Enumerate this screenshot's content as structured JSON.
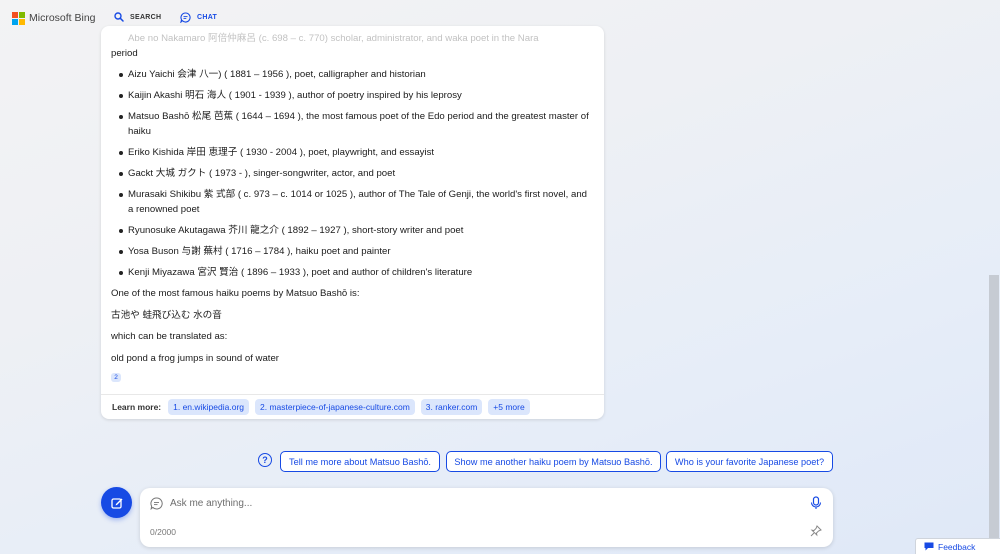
{
  "header": {
    "brand": "Microsoft Bing",
    "tabs": [
      {
        "label": "SEARCH",
        "icon": "search-icon"
      },
      {
        "label": "CHAT",
        "icon": "chat-bubble-icon",
        "active": true
      }
    ]
  },
  "answer": {
    "faded_line": "Abe no Nakamaro 阿倍仲麻呂 (c. 698 – c. 770) scholar, administrator, and waka poet in the Nara",
    "faded_continuation": "period",
    "poets": [
      "Aizu Yaichi 会津 八一) ( 1881 – 1956 ), poet, calligrapher and historian",
      "Kaijin Akashi 明石 海人 ( 1901 - 1939 ), author of poetry inspired by his leprosy",
      "Matsuo Bashō 松尾 芭蕉 ( 1644 – 1694 ), the most famous poet of the Edo period and the greatest master of haiku",
      "Eriko Kishida 岸田 恵理子 ( 1930 - 2004 ), poet, playwright, and essayist",
      "Gackt 大城 ガクト ( 1973 - ), singer-songwriter, actor, and poet",
      "Murasaki Shikibu 紫 式部 ( c. 973 – c. 1014 or 1025 ), author of The Tale of Genji, the world's first novel, and a renowned poet",
      "Ryunosuke Akutagawa 芥川 龍之介 ( 1892 – 1927 ), short-story writer and poet",
      "Yosa Buson 与謝 蕪村 ( 1716 – 1784 ), haiku poet and painter",
      "Kenji Miyazawa 宮沢 賢治 ( 1896 – 1933 ), poet and author of children's literature"
    ],
    "para_intro": "One of the most famous haiku poems by Matsuo Bashō is:",
    "haiku_jp": "古池や 蛙飛び込む 水の音",
    "para_translated": "which can be translated as:",
    "haiku_en": "old pond a frog jumps in sound of water",
    "citation": "2",
    "learn_more": {
      "label": "Learn more:",
      "links": [
        "1. en.wikipedia.org",
        "2. masterpiece-of-japanese-culture.com",
        "3. ranker.com",
        "+5 more"
      ]
    }
  },
  "suggestions": [
    "Tell me more about Matsuo Bashō.",
    "Show me another haiku poem by Matsuo Bashō.",
    "Who is your favorite Japanese poet?"
  ],
  "input": {
    "placeholder": "Ask me anything...",
    "char_count": "0/2000"
  },
  "feedback_label": "Feedback",
  "colors": {
    "accent": "#174ae4",
    "chip_bg": "#dbe6fc",
    "ms_red": "#f25022",
    "ms_green": "#7fba00",
    "ms_blue": "#00a4ef",
    "ms_yellow": "#ffb900"
  }
}
